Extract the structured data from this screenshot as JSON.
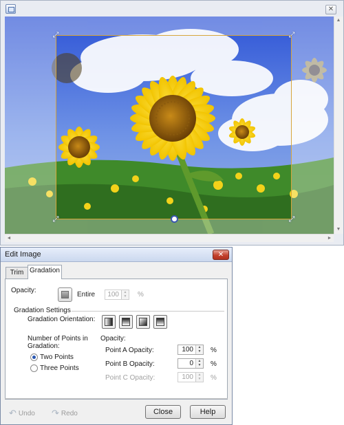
{
  "top_window": {
    "icon": "app-window-icon",
    "close_glyph": "✕",
    "scroll_up_glyph": "▲",
    "scroll_down_glyph": "▼",
    "scroll_left_glyph": "◄",
    "scroll_right_glyph": "►",
    "handle_glyph": "⤢"
  },
  "dialog": {
    "title": "Edit Image",
    "close_glyph": "✕",
    "tabs": [
      {
        "label": "Trim",
        "active": false
      },
      {
        "label": "Gradation",
        "active": true
      }
    ],
    "opacity": {
      "label": "Opacity:",
      "entire_label": "Entire",
      "value": "100",
      "unit": "%"
    },
    "gradation_settings_label": "Gradation Settings",
    "orientation": {
      "label": "Gradation Orientation:",
      "options": [
        "left-right-gradient-icon",
        "top-bottom-gradient-icon",
        "diagonal-gradient-icon",
        "bottom-top-gradient-icon"
      ]
    },
    "points": {
      "label_line1": "Number of Points in",
      "label_line2": "Gradation:",
      "options": [
        {
          "label": "Two Points",
          "checked": true
        },
        {
          "label": "Three Points",
          "checked": false
        }
      ]
    },
    "point_opacity": {
      "label": "Opacity:",
      "rows": [
        {
          "label": "Point A Opacity:",
          "value": "100",
          "unit": "%",
          "enabled": true
        },
        {
          "label": "Point B Opacity:",
          "value": "0",
          "unit": "%",
          "enabled": true
        },
        {
          "label": "Point C Opacity:",
          "value": "100",
          "unit": "%",
          "enabled": false
        }
      ]
    },
    "footer": {
      "undo_label": "Undo",
      "redo_label": "Redo",
      "close_label": "Close",
      "help_label": "Help"
    }
  }
}
